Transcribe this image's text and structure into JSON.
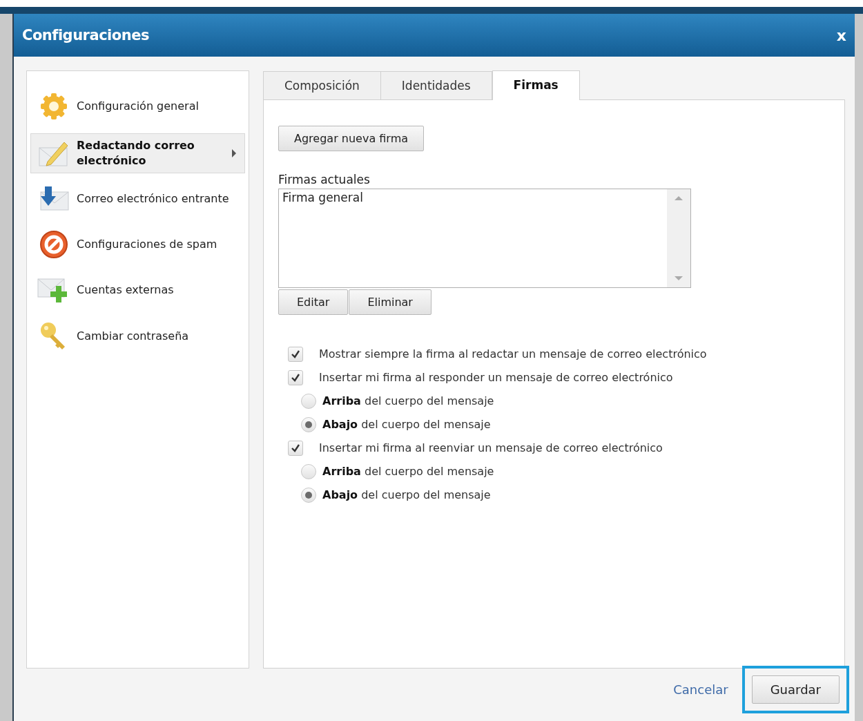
{
  "window": {
    "title": "Configuraciones",
    "close": "x"
  },
  "sidebar": {
    "items": [
      {
        "label": "Configuración general",
        "selected": false
      },
      {
        "label": "Redactando correo electrónico",
        "selected": true
      },
      {
        "label": "Correo electrónico entrante",
        "selected": false
      },
      {
        "label": "Configuraciones de spam",
        "selected": false
      },
      {
        "label": "Cuentas externas",
        "selected": false
      },
      {
        "label": "Cambiar contraseña",
        "selected": false
      }
    ]
  },
  "tabs": [
    {
      "label": "Composición",
      "selected": false
    },
    {
      "label": "Identidades",
      "selected": false
    },
    {
      "label": "Firmas",
      "selected": true
    }
  ],
  "add_button": "Agregar nueva firma",
  "signatures": {
    "label": "Firmas actuales",
    "items": [
      "Firma general"
    ],
    "buttons": [
      "Editar",
      "Eliminar"
    ]
  },
  "options": [
    {
      "kind": "checkbox",
      "label": "Mostrar siempre la firma al redactar un mensaje de correo electrónico",
      "checked": true
    },
    {
      "kind": "checkbox",
      "label": "Insertar mi firma al responder un mensaje de correo electrónico",
      "checked": true
    },
    {
      "kind": "radio",
      "label": "**Arriba** del cuerpo del mensaje",
      "selected": false
    },
    {
      "kind": "radio",
      "label": "**Abajo** del cuerpo del mensaje",
      "selected": true
    },
    {
      "kind": "checkbox",
      "label": "Insertar mi firma al reenviar un mensaje de correo electrónico",
      "checked": true
    },
    {
      "kind": "radio",
      "label": "**Arriba** del cuerpo del mensaje",
      "selected": false
    },
    {
      "kind": "radio",
      "label": "**Abajo** del cuerpo del mensaje",
      "selected": true
    }
  ],
  "footer": {
    "cancel": "Cancelar",
    "save": {
      "label": "Guardar",
      "highlighted": true
    }
  }
}
